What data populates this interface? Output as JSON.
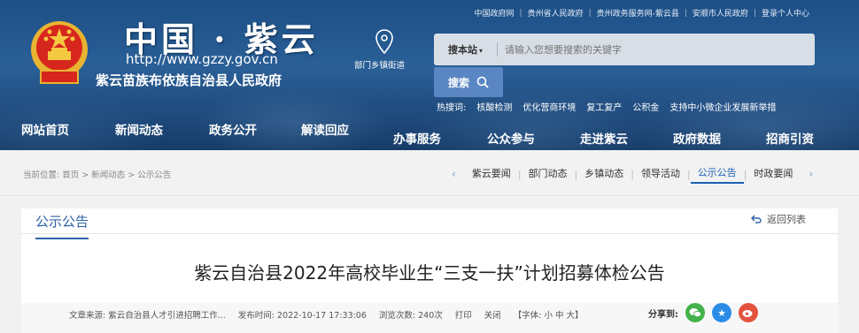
{
  "header": {
    "site_title": "中国 · 紫云",
    "site_url": "http://www.gzzy.gov.cn",
    "site_subtitle": "紫云苗族布依族自治县人民政府",
    "top_links": [
      "中国政府网",
      "贵州省人民政府",
      "贵州政务服务网-紫云县",
      "安顺市人民政府",
      "登录个人中心"
    ],
    "location_label": "部门乡镇街道",
    "search": {
      "scope": "搜本站",
      "placeholder": "请输入您想要搜索的关键字",
      "button": "搜索"
    },
    "hot_words_label": "热搜词:",
    "hot_words": [
      "核酸检测",
      "优化营商环境",
      "复工复产",
      "公积金",
      "支持中小微企业发展新举措"
    ],
    "nav": [
      "网站首页",
      "新闻动态",
      "政务公开",
      "解读回应",
      "办事服务",
      "公众参与",
      "走进紫云",
      "政府数据",
      "招商引资"
    ]
  },
  "crumb": {
    "label": "当前位置:",
    "path": "首页 > 新闻动态 > 公示公告"
  },
  "tabs": [
    "紫云要闻",
    "部门动态",
    "乡镇动态",
    "领导活动",
    "公示公告",
    "时政要闻"
  ],
  "active_tab": "公示公告",
  "content": {
    "section_title": "公示公告",
    "back_label": "返回列表",
    "article_title": "紫云自治县2022年高校毕业生“三支一扶”计划招募体检公告",
    "meta": {
      "source": "文章来源: 紫云自治县人才引进招聘工作...",
      "time": "发布时间: 2022-10-17 17:33:06",
      "views": "浏览次数: 240次",
      "print": "打印",
      "close": "关闭",
      "font": "【字体: 小 中 大】",
      "share_label": "分享到:"
    }
  },
  "colors": {
    "header_blue": "#1f4f86",
    "accent": "#1c5fb5",
    "search_btn": "#5a86c3"
  }
}
